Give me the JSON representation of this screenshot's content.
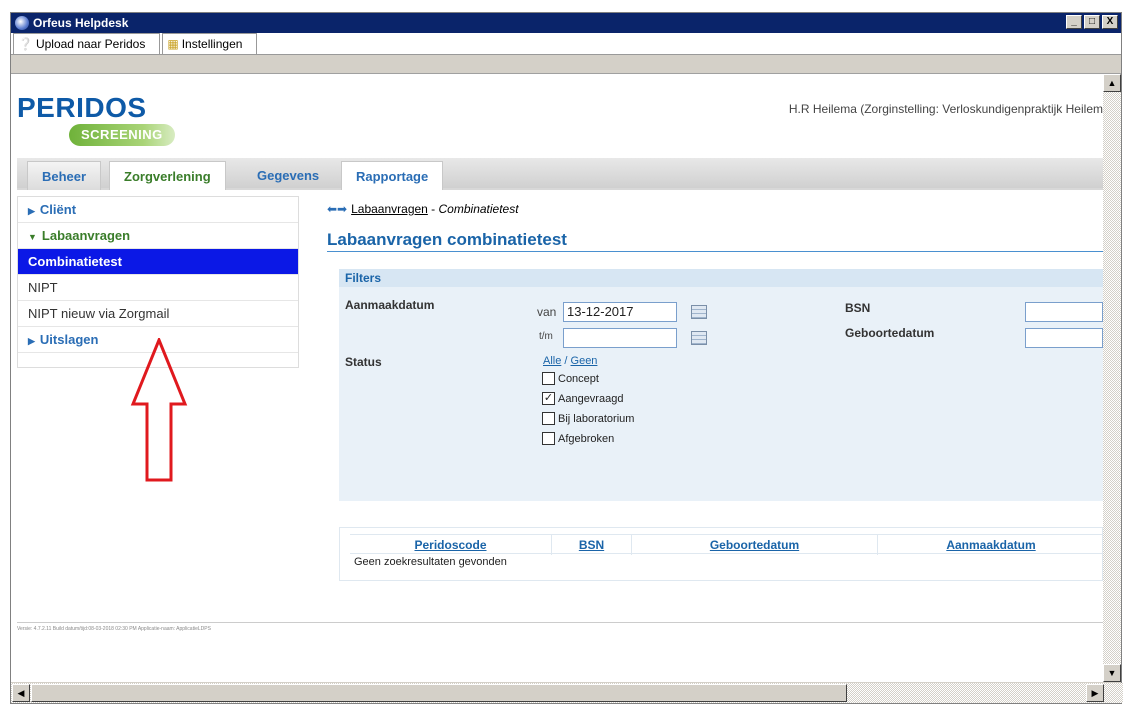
{
  "window": {
    "title": "Orfeus Helpdesk",
    "controls": [
      "_",
      "□",
      "X"
    ]
  },
  "app_tabs": [
    {
      "label": "Upload naar Peridos",
      "icon": "help-icon"
    },
    {
      "label": "Instellingen",
      "icon": "settings-icon"
    }
  ],
  "header": {
    "logo_main": "PERIDOS",
    "logo_sub": "SCREENING",
    "user": "H.R Heilema (Zorginstelling: Verloskundigenpraktijk Heilem"
  },
  "nav_tabs": [
    "Beheer",
    "Zorgverlening",
    "Gegevens",
    "Rapportage"
  ],
  "nav_active": "Zorgverlening",
  "sidebar": {
    "client": "Cliënt",
    "labaanvragen": "Labaanvragen",
    "items": [
      "Combinatietest",
      "NIPT",
      "NIPT nieuw via Zorgmail"
    ],
    "uitslagen": "Uitslagen"
  },
  "breadcrumb": {
    "link": "Labaanvragen",
    "separator": " - ",
    "current": "Combinatietest"
  },
  "page_title": "Labaanvragen combinatietest",
  "filters": {
    "title": "Filters",
    "aanmaakdatum_label": "Aanmaakdatum",
    "van_label": "van",
    "van_value": "13-12-2017",
    "tm_label": "t/m",
    "tm_value": "",
    "bsn_label": "BSN",
    "bsn_value": "",
    "geboortedatum_label": "Geboortedatum",
    "geboortedatum_value": "",
    "status_label": "Status",
    "alle": "Alle",
    "slash": " / ",
    "geen": "Geen",
    "status_options": [
      {
        "label": "Concept",
        "checked": false
      },
      {
        "label": "Aangevraagd",
        "checked": true
      },
      {
        "label": "Bij laboratorium",
        "checked": false
      },
      {
        "label": "Afgebroken",
        "checked": false
      }
    ]
  },
  "results": {
    "columns": [
      "Peridoscode",
      "BSN",
      "Geboortedatum",
      "Aanmaakdatum"
    ],
    "empty": "Geen zoekresultaten gevonden"
  },
  "footer": "Versie: 4.7.2.11 Build datum/tijd:08-03-2018 02:30 PM Applicatie-naam: ApplicatieLDPS",
  "colors": {
    "accent_blue": "#1a64a8",
    "selected": "#0b18e6",
    "green": "#3a7d2a",
    "arrow": "#e0191e"
  }
}
